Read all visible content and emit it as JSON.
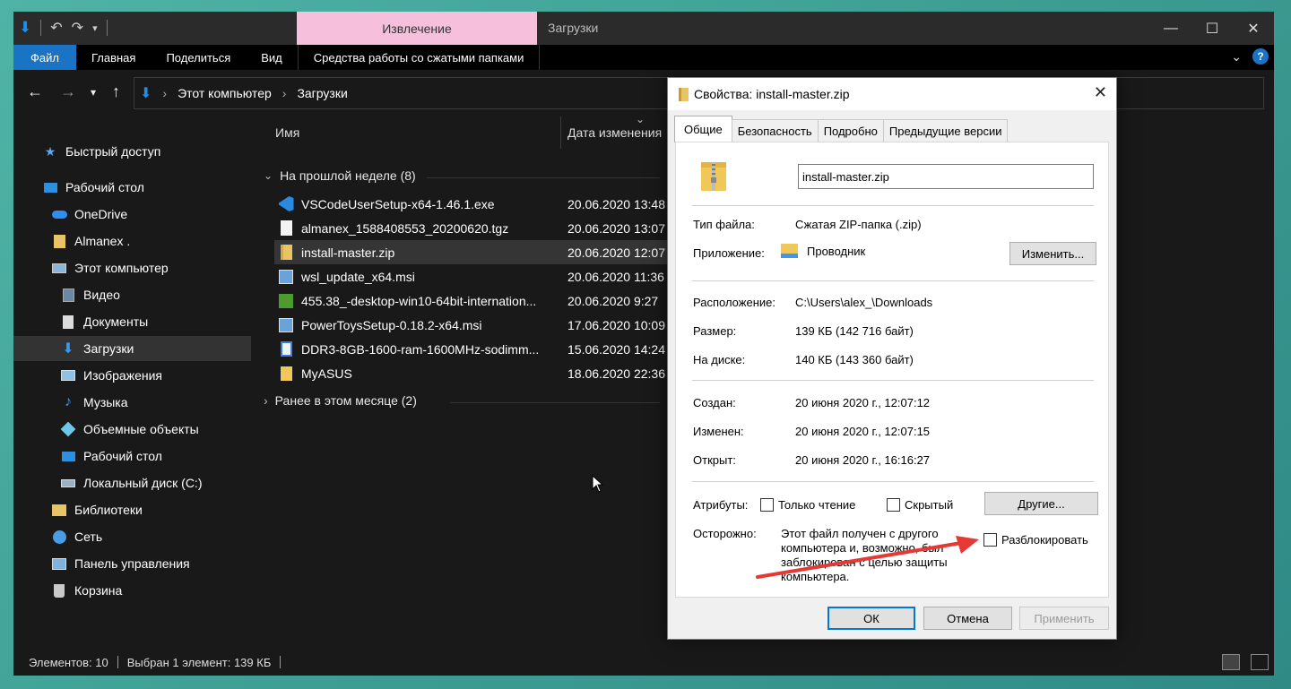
{
  "explorer": {
    "window_title": "Загрузки",
    "context_tab": "Извлечение",
    "ribbon_tabs": [
      "Файл",
      "Главная",
      "Поделиться",
      "Вид",
      "Средства работы со сжатыми папками"
    ],
    "breadcrumb": [
      "Этот компьютер",
      "Загрузки"
    ],
    "columns": {
      "name": "Имя",
      "date": "Дата изменения"
    },
    "nav_items": [
      {
        "label": "Быстрый доступ",
        "icon": "star-icon"
      },
      {
        "label": "Рабочий стол",
        "icon": "desktop-icon"
      },
      {
        "label": "OneDrive",
        "icon": "cloud-icon"
      },
      {
        "label": "Almanex .",
        "icon": "user-folder-icon"
      },
      {
        "label": "Этот компьютер",
        "icon": "computer-icon"
      },
      {
        "label": "Видео",
        "icon": "video-icon"
      },
      {
        "label": "Документы",
        "icon": "document-icon"
      },
      {
        "label": "Загрузки",
        "icon": "download-icon"
      },
      {
        "label": "Изображения",
        "icon": "pictures-icon"
      },
      {
        "label": "Музыка",
        "icon": "music-icon"
      },
      {
        "label": "Объемные объекты",
        "icon": "3d-objects-icon"
      },
      {
        "label": "Рабочий стол",
        "icon": "desktop-icon"
      },
      {
        "label": "Локальный диск (C:)",
        "icon": "drive-icon"
      },
      {
        "label": "Библиотеки",
        "icon": "libraries-icon"
      },
      {
        "label": "Сеть",
        "icon": "network-icon"
      },
      {
        "label": "Панель управления",
        "icon": "control-panel-icon"
      },
      {
        "label": "Корзина",
        "icon": "recycle-bin-icon"
      }
    ],
    "groups": [
      {
        "label": "На прошлой неделе (8)"
      },
      {
        "label": "Ранее в этом месяце (2)"
      }
    ],
    "files": [
      {
        "name": "VSCodeUserSetup-x64-1.46.1.exe",
        "date": "20.06.2020 13:48",
        "icon": "vscode-icon"
      },
      {
        "name": "almanex_1588408553_20200620.tgz",
        "date": "20.06.2020 13:07",
        "icon": "file-icon"
      },
      {
        "name": "install-master.zip",
        "date": "20.06.2020 12:07",
        "icon": "zip-folder-icon"
      },
      {
        "name": "wsl_update_x64.msi",
        "date": "20.06.2020 11:36",
        "icon": "installer-icon"
      },
      {
        "name": "455.38_-desktop-win10-64bit-internation...",
        "date": "20.06.2020 9:27",
        "icon": "nvidia-icon"
      },
      {
        "name": "PowerToysSetup-0.18.2-x64.msi",
        "date": "17.06.2020 10:09",
        "icon": "installer-icon"
      },
      {
        "name": "DDR3-8GB-1600-ram-1600MHz-sodimm...",
        "date": "15.06.2020 14:24",
        "icon": "file-icon"
      },
      {
        "name": "MyASUS",
        "date": "18.06.2020 22:36",
        "icon": "folder-icon"
      }
    ],
    "status": {
      "count": "Элементов: 10",
      "selected": "Выбран 1 элемент: 139 КБ"
    }
  },
  "dialog": {
    "title": "Свойства: install-master.zip",
    "tabs": [
      "Общие",
      "Безопасность",
      "Подробно",
      "Предыдущие версии"
    ],
    "file_name": "install-master.zip",
    "props": {
      "type_label": "Тип файла:",
      "type_value": "Сжатая ZIP-папка (.zip)",
      "app_label": "Приложение:",
      "app_value": "Проводник",
      "change_btn": "Изменить...",
      "location_label": "Расположение:",
      "location_value": "C:\\Users\\alex_\\Downloads",
      "size_label": "Размер:",
      "size_value": "139 КБ (142 716 байт)",
      "disk_label": "На диске:",
      "disk_value": "140 КБ (143 360 байт)",
      "created_label": "Создан:",
      "created_value": "20 июня 2020 г., 12:07:12",
      "modified_label": "Изменен:",
      "modified_value": "20 июня 2020 г., 12:07:15",
      "opened_label": "Открыт:",
      "opened_value": "20 июня 2020 г., 16:16:27",
      "attrs_label": "Атрибуты:",
      "readonly": "Только чтение",
      "hidden": "Скрытый",
      "other_btn": "Другие...",
      "caution_label": "Осторожно:",
      "caution_text": "Этот файл получен с другого компьютера и, возможно, был заблокирован с целью защиты компьютера.",
      "unblock": "Разблокировать"
    },
    "buttons": {
      "ok": "ОК",
      "cancel": "Отмена",
      "apply": "Применить"
    }
  },
  "colors": {
    "accent": "#1a73c4",
    "context_tab": "#f6bfdb",
    "arrow": "#e53935"
  }
}
